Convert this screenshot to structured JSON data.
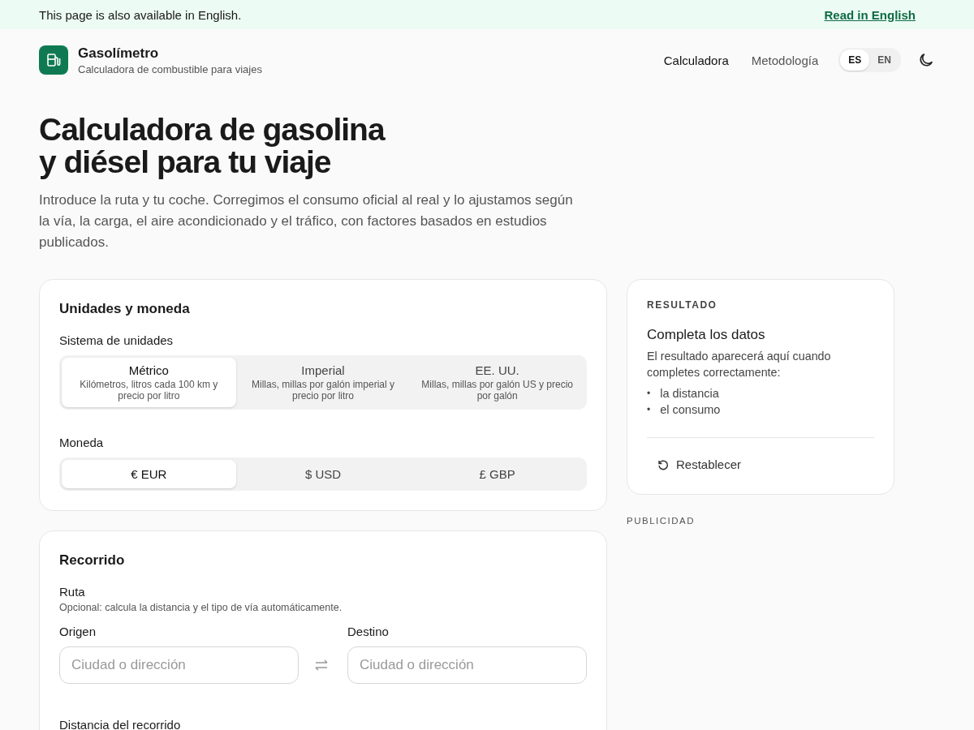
{
  "banner": {
    "text": "This page is also available in English.",
    "link": "Read in English"
  },
  "header": {
    "title": "Gasolímetro",
    "subtitle": "Calculadora de combustible para viajes",
    "nav": [
      {
        "label": "Calculadora",
        "selected": true
      },
      {
        "label": "Metodología",
        "selected": false
      }
    ],
    "languages": [
      {
        "label": "ES",
        "selected": true
      },
      {
        "label": "EN",
        "selected": false
      }
    ]
  },
  "hero": {
    "title_lines": [
      "Calculadora de gasolina",
      "y diésel para tu viaje"
    ],
    "intro": "Introduce la ruta y tu coche. Corregimos el consumo oficial al real y lo ajustamos según la vía, la carga, el aire acondicionado y el tráfico, con factores basados en estudios publicados."
  },
  "units_card": {
    "title": "Unidades y moneda",
    "unit_label": "Sistema de unidades",
    "unit_options": [
      {
        "label": "Métrico",
        "description": "Kilómetros, litros cada 100 km y precio por litro",
        "selected": true
      },
      {
        "label": "Imperial",
        "description": "Millas, millas por galón imperial y precio por litro",
        "selected": false
      },
      {
        "label": "EE. UU.",
        "description": "Millas, millas por galón US y precio por galón",
        "selected": false
      }
    ],
    "currency_label": "Moneda",
    "currency_options": [
      {
        "label": "€ EUR",
        "selected": true
      },
      {
        "label": "$ USD",
        "selected": false
      },
      {
        "label": "£ GBP",
        "selected": false
      }
    ]
  },
  "route_card": {
    "title": "Recorrido",
    "route_label": "Ruta",
    "route_hint": "Opcional: calcula la distancia y el tipo de vía automáticamente.",
    "fields": [
      {
        "label": "Origen",
        "placeholder": "Ciudad o dirección"
      },
      {
        "label": "Destino",
        "placeholder": "Ciudad o dirección"
      }
    ],
    "distance_label": "Distancia del recorrido"
  },
  "result": {
    "eyebrow": "RESULTADO",
    "title": "Completa los datos",
    "text": "El resultado aparecerá aquí cuando completes correctamente:",
    "items": [
      {
        "marker": "•",
        "text": "la distancia"
      },
      {
        "marker": "•",
        "text": "el consumo"
      }
    ],
    "reset": "Restablecer"
  },
  "ad_label": "PUBLICIDAD"
}
